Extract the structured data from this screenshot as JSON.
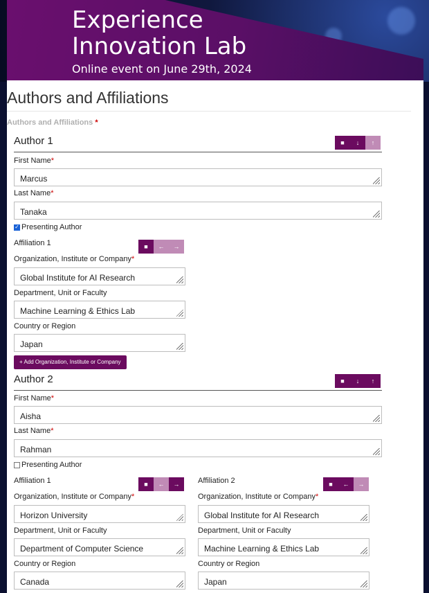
{
  "banner": {
    "title_line1": "Experience",
    "title_line2": "Innovation Lab",
    "subtitle": "Online event on June 29th, 2024"
  },
  "page": {
    "title": "Authors and Affiliations",
    "section_label": "Authors and Affiliations",
    "required_mark": "*"
  },
  "icons": {
    "delete": "trash-icon",
    "move_down": "arrow-down-icon",
    "move_up": "arrow-up-icon",
    "move_left": "arrow-left-icon",
    "move_right": "arrow-right-icon"
  },
  "labels": {
    "first_name": "First Name",
    "last_name": "Last Name",
    "presenting": "Presenting Author",
    "organization": "Organization, Institute or Company",
    "department": "Department, Unit or Faculty",
    "country": "Country or Region",
    "add_org": "+ Add Organization, Institute or Company"
  },
  "authors": [
    {
      "heading": "Author 1",
      "first_name": "Marcus",
      "last_name": "Tanaka",
      "presenting": true,
      "affiliations": [
        {
          "heading": "Affiliation 1",
          "organization": "Global Institute for AI Research",
          "department": "Machine Learning & Ethics Lab",
          "country": "Japan"
        }
      ]
    },
    {
      "heading": "Author 2",
      "first_name": "Aisha",
      "last_name": "Rahman",
      "presenting": false,
      "affiliations": [
        {
          "heading": "Affiliation 1",
          "organization": "Horizon University",
          "department": "Department of Computer Science",
          "country": "Canada"
        },
        {
          "heading": "Affiliation 2",
          "organization": "Global Institute for AI Research",
          "department": "Machine Learning & Ethics Lab",
          "country": "Japan"
        }
      ]
    }
  ],
  "colors": {
    "accent": "#6b0b5f",
    "accent_light": "#c08bb6",
    "required": "#cc0000"
  }
}
